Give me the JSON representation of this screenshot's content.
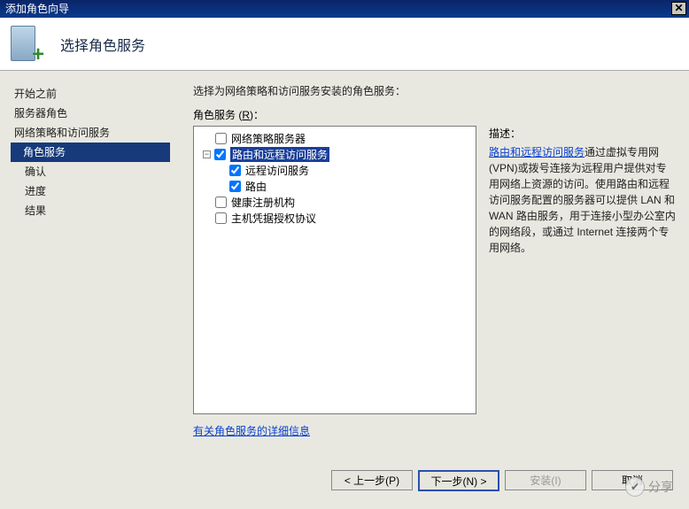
{
  "window_title": "添加角色向导",
  "close_glyph": "✕",
  "page_title": "选择角色服务",
  "sidebar": {
    "steps": [
      {
        "label": "开始之前"
      },
      {
        "label": "服务器角色"
      },
      {
        "label": "网络策略和访问服务"
      },
      {
        "label": "角色服务"
      },
      {
        "label": "确认"
      },
      {
        "label": "进度"
      },
      {
        "label": "结果"
      }
    ]
  },
  "content": {
    "instruction": "选择为网络策略和访问服务安装的角色服务：",
    "roles_label_prefix": "角色服务 (",
    "roles_label_accel": "R",
    "roles_label_suffix": ")：",
    "tree": [
      {
        "label": "网络策略服务器",
        "checked": false,
        "level": 0
      },
      {
        "label": "路由和远程访问服务",
        "checked": true,
        "level": 0,
        "selected": true,
        "expandable": true,
        "expanded": true
      },
      {
        "label": "远程访问服务",
        "checked": true,
        "level": 1
      },
      {
        "label": "路由",
        "checked": true,
        "level": 1
      },
      {
        "label": "健康注册机构",
        "checked": false,
        "level": 0
      },
      {
        "label": "主机凭据授权协议",
        "checked": false,
        "level": 0
      }
    ],
    "desc_title": "描述：",
    "desc_link": "路由和远程访问服务",
    "desc_text_tail": "通过虚拟专用网(VPN)或拨号连接为远程用户提供对专用网络上资源的访问。使用路由和远程访问服务配置的服务器可以提供 LAN 和 WAN 路由服务，用于连接小型办公室内的网络段，或通过 Internet 连接两个专用网络。",
    "info_link": "有关角色服务的详细信息"
  },
  "buttons": {
    "prev": "< 上一步(P)",
    "next": "下一步(N) >",
    "install": "安装(I)",
    "cancel": "取消"
  },
  "watermark": "分享"
}
